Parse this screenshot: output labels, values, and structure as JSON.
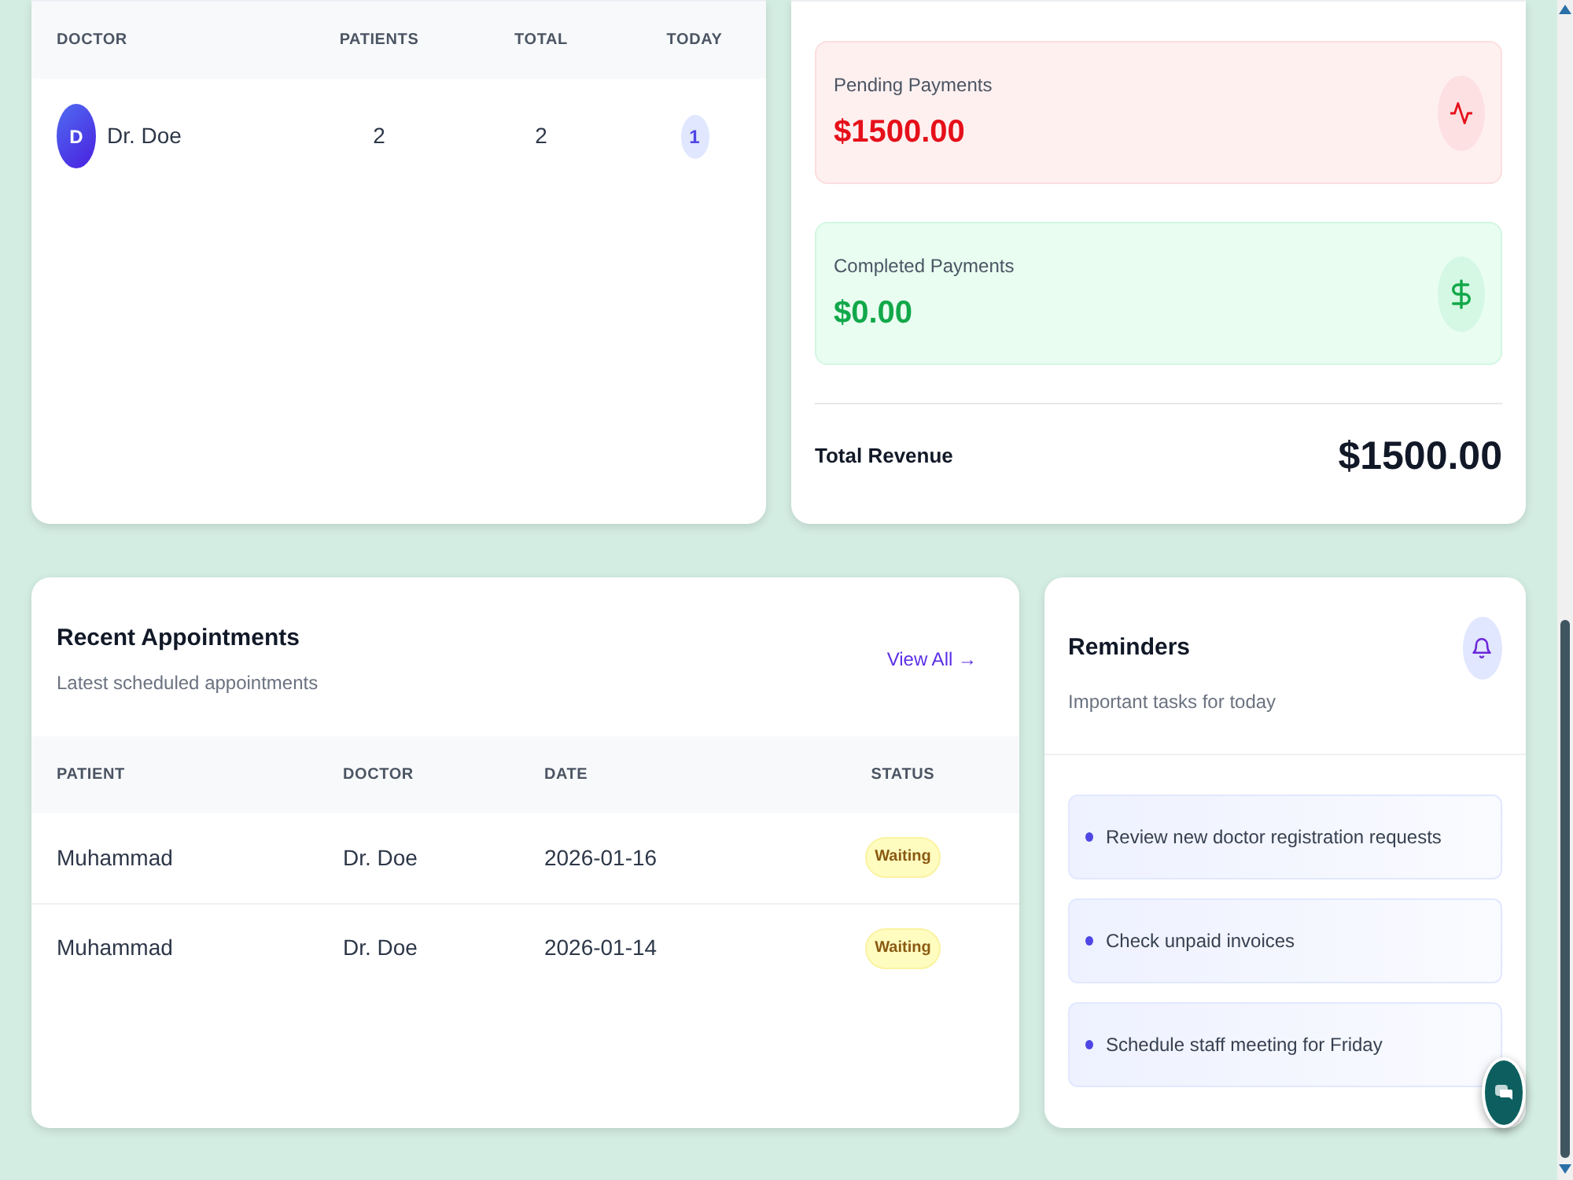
{
  "doctor_table": {
    "columns": [
      "DOCTOR",
      "PATIENTS",
      "TOTAL",
      "TODAY"
    ],
    "rows": [
      {
        "initial": "D",
        "name": "Dr. Doe",
        "patients": "2",
        "total": "2",
        "today": "1"
      }
    ]
  },
  "payments": {
    "items": [
      {
        "kind": "pending",
        "label": "Pending Payments",
        "amount": "$1500.00"
      },
      {
        "kind": "completed",
        "label": "Completed Payments",
        "amount": "$0.00"
      }
    ],
    "total": {
      "label": "Total Revenue",
      "amount": "$1500.00"
    }
  },
  "appointments": {
    "title": "Recent Appointments",
    "subtitle": "Latest scheduled appointments",
    "view_all": "View All →",
    "columns": [
      "PATIENT",
      "DOCTOR",
      "DATE",
      "STATUS"
    ],
    "rows": [
      {
        "patient": "Muhammad",
        "doctor": "Dr. Doe",
        "date": "2026-01-16",
        "status": "Waiting"
      },
      {
        "patient": "Muhammad",
        "doctor": "Dr. Doe",
        "date": "2026-01-14",
        "status": "Waiting"
      }
    ]
  },
  "reminders": {
    "title": "Reminders",
    "subtitle": "Important tasks for today",
    "items": [
      "Review new doctor registration requests",
      "Check unpaid invoices",
      "Schedule staff meeting for Friday"
    ]
  }
}
